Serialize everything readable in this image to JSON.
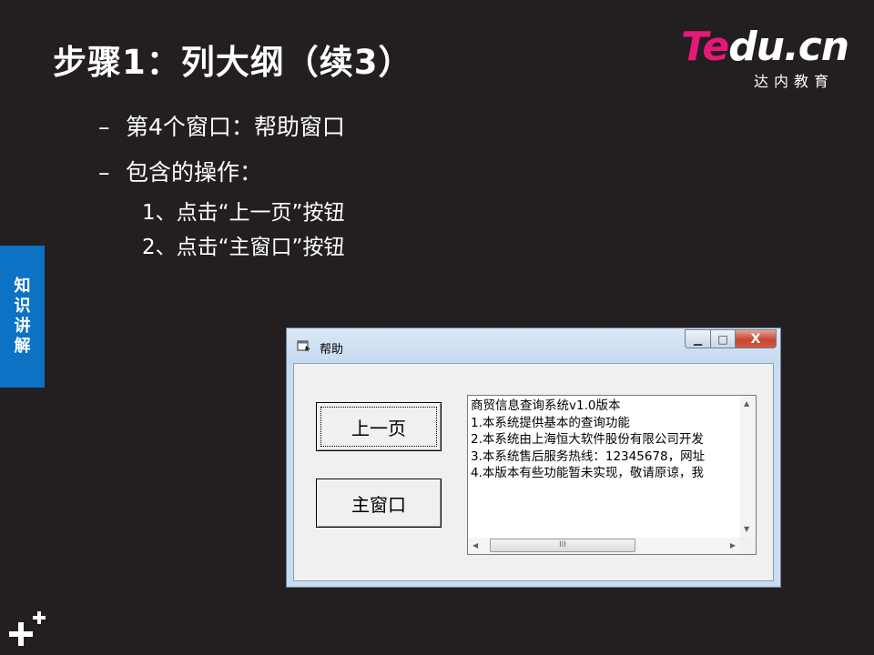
{
  "slide": {
    "title": "步骤1：列大纲（续3）",
    "logo_main_te": "Te",
    "logo_main_rest": "du.cn",
    "logo_sub": "达内教育",
    "side_tab": [
      "知",
      "识",
      "讲",
      "解"
    ],
    "bullets": [
      {
        "dash": "–",
        "text": "第4个窗口：帮助窗口"
      },
      {
        "dash": "–",
        "text": "包含的操作："
      }
    ],
    "sub_items": [
      "1、点击“上一页”按钮",
      "2、点击“主窗口”按钮"
    ],
    "colors": {
      "background": "#231f20",
      "tab": "#0b72c4",
      "logo_pink": "#e6197a"
    }
  },
  "window": {
    "title": "帮助",
    "controls": {
      "minimize": "▁",
      "maximize": "□",
      "close": "X"
    },
    "buttons": {
      "prev_page": "上一页",
      "main_window": "主窗口"
    },
    "textbox_lines": [
      "商贸信息查询系统v1.0版本",
      "1.本系统提供基本的查询功能",
      "2.本系统由上海恒大软件股份有限公司开发",
      "3.本系统售后服务热线：12345678，网址",
      "4.本版本有些功能暂未实现，敬请原谅，我"
    ],
    "scrollbar": {
      "up": "▲",
      "down": "▼",
      "left": "◀",
      "right": "▶",
      "grip": "III"
    }
  }
}
